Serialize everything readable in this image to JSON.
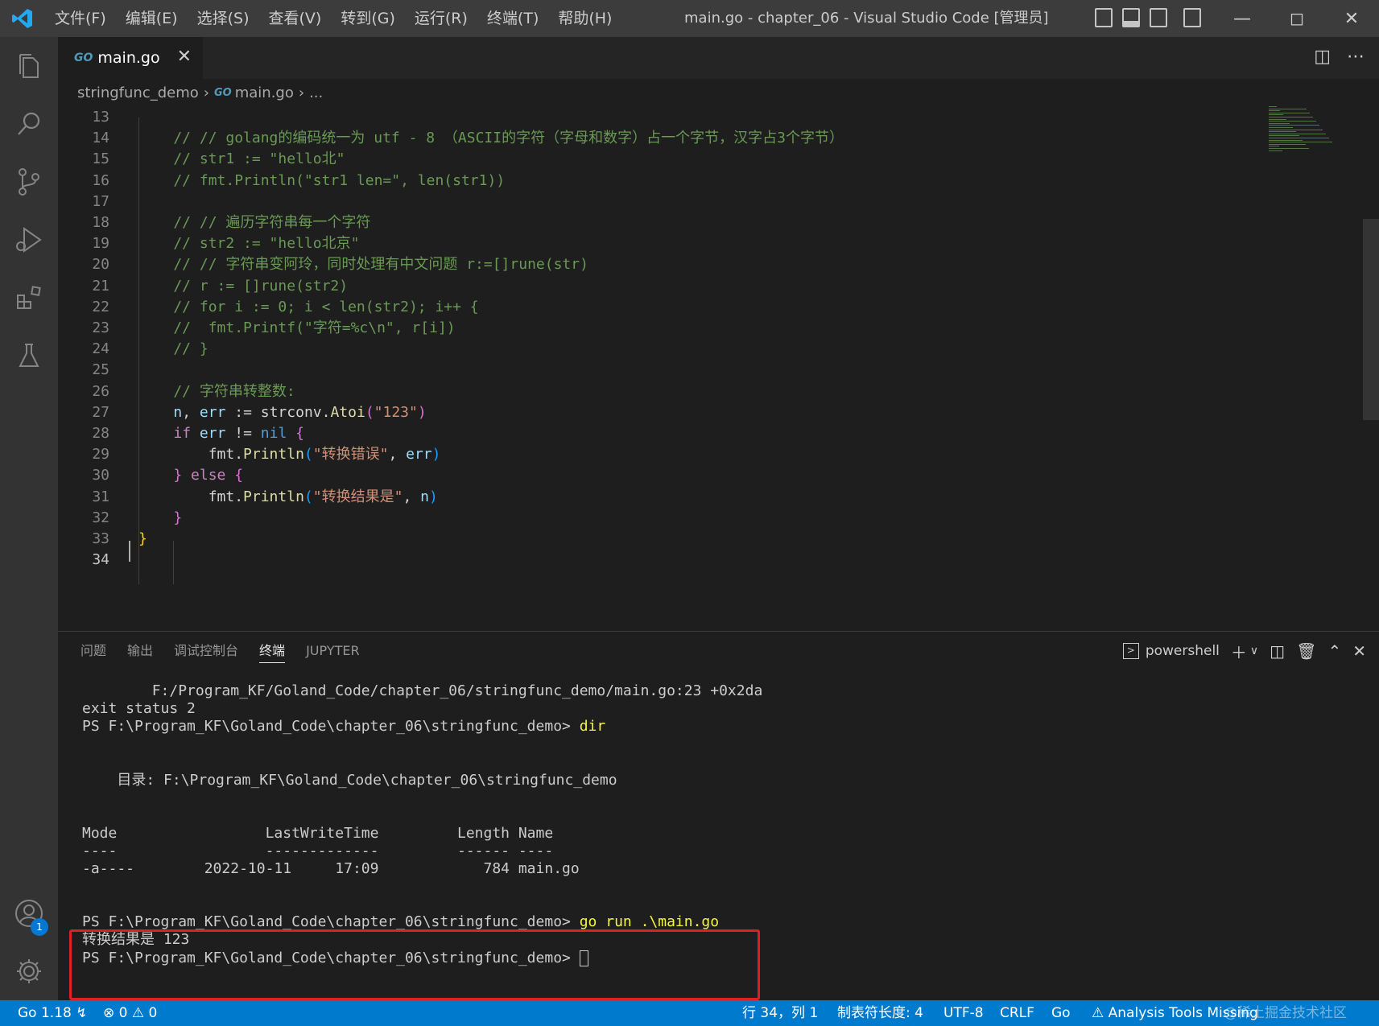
{
  "titlebar": {
    "menu": [
      "文件(F)",
      "编辑(E)",
      "选择(S)",
      "查看(V)",
      "转到(G)",
      "运行(R)",
      "终端(T)",
      "帮助(H)"
    ],
    "title": "main.go - chapter_06 - Visual Studio Code [管理员]"
  },
  "tabs": {
    "active": {
      "icon": "GO",
      "label": "main.go"
    }
  },
  "breadcrumb": {
    "folder": "stringfunc_demo",
    "icon": "GO",
    "file": "main.go",
    "more": "..."
  },
  "editor": {
    "lines": [
      {
        "n": "13",
        "tokens": []
      },
      {
        "n": "14",
        "tokens": [
          [
            "cm",
            "    // // golang的编码统一为 utf - 8 （ASCII的字符（字母和数字）占一个字节，汉字占3个字节）"
          ]
        ]
      },
      {
        "n": "15",
        "tokens": [
          [
            "cm",
            "    // str1 := \"hello北\""
          ]
        ]
      },
      {
        "n": "16",
        "tokens": [
          [
            "cm",
            "    // fmt.Println(\"str1 len=\", len(str1))"
          ]
        ]
      },
      {
        "n": "17",
        "tokens": []
      },
      {
        "n": "18",
        "tokens": [
          [
            "cm",
            "    // // 遍历字符串每一个字符"
          ]
        ]
      },
      {
        "n": "19",
        "tokens": [
          [
            "cm",
            "    // str2 := \"hello北京\""
          ]
        ]
      },
      {
        "n": "20",
        "tokens": [
          [
            "cm",
            "    // // 字符串变阿玲，同时处理有中文问题 r:=[]rune(str)"
          ]
        ]
      },
      {
        "n": "21",
        "tokens": [
          [
            "cm",
            "    // r := []rune(str2)"
          ]
        ]
      },
      {
        "n": "22",
        "tokens": [
          [
            "cm",
            "    // for i := 0; i < len(str2); i++ {"
          ]
        ]
      },
      {
        "n": "23",
        "tokens": [
          [
            "cm",
            "    //  fmt.Printf(\"字符=%c\\n\", r[i])"
          ]
        ]
      },
      {
        "n": "24",
        "tokens": [
          [
            "cm",
            "    // }"
          ]
        ]
      },
      {
        "n": "25",
        "tokens": []
      },
      {
        "n": "26",
        "tokens": [
          [
            "cm",
            "    // 字符串转整数:"
          ]
        ]
      },
      {
        "n": "27",
        "tokens": [
          [
            "pkg",
            "    "
          ],
          [
            "var",
            "n"
          ],
          [
            "pkg",
            ", "
          ],
          [
            "var",
            "err"
          ],
          [
            "pkg",
            " := strconv."
          ],
          [
            "fn",
            "Atoi"
          ],
          [
            "br2",
            "("
          ],
          [
            "str",
            "\"123\""
          ],
          [
            "br2",
            ")"
          ]
        ]
      },
      {
        "n": "28",
        "tokens": [
          [
            "pkg",
            "    "
          ],
          [
            "kw",
            "if"
          ],
          [
            "pkg",
            " "
          ],
          [
            "var",
            "err"
          ],
          [
            "pkg",
            " != "
          ],
          [
            "kw2",
            "nil"
          ],
          [
            "pkg",
            " "
          ],
          [
            "br2",
            "{"
          ]
        ]
      },
      {
        "n": "29",
        "tokens": [
          [
            "pkg",
            "        fmt."
          ],
          [
            "fn",
            "Println"
          ],
          [
            "br3",
            "("
          ],
          [
            "str",
            "\"转换错误\""
          ],
          [
            "pkg",
            ", "
          ],
          [
            "var",
            "err"
          ],
          [
            "br3",
            ")"
          ]
        ]
      },
      {
        "n": "30",
        "tokens": [
          [
            "pkg",
            "    "
          ],
          [
            "br2",
            "}"
          ],
          [
            "pkg",
            " "
          ],
          [
            "kw",
            "else"
          ],
          [
            "pkg",
            " "
          ],
          [
            "br2",
            "{"
          ]
        ]
      },
      {
        "n": "31",
        "tokens": [
          [
            "pkg",
            "        fmt."
          ],
          [
            "fn",
            "Println"
          ],
          [
            "br3",
            "("
          ],
          [
            "str",
            "\"转换结果是\""
          ],
          [
            "pkg",
            ", "
          ],
          [
            "var",
            "n"
          ],
          [
            "br3",
            ")"
          ]
        ]
      },
      {
        "n": "32",
        "tokens": [
          [
            "pkg",
            "    "
          ],
          [
            "br2",
            "}"
          ]
        ]
      },
      {
        "n": "33",
        "tokens": [
          [
            "br1",
            "}"
          ]
        ]
      },
      {
        "n": "34",
        "tokens": [],
        "active": true
      }
    ]
  },
  "panel": {
    "tabs": [
      "问题",
      "输出",
      "调试控制台",
      "终端",
      "JUPYTER"
    ],
    "active_tab": "终端",
    "shell": "powershell",
    "terminal": [
      {
        "text": "        F:/Program_KF/Goland_Code/chapter_06/stringfunc_demo/main.go:23 +0x2da",
        "cmd": ""
      },
      {
        "text": "exit status 2",
        "cmd": ""
      },
      {
        "text": "PS F:\\Program_KF\\Goland_Code\\chapter_06\\stringfunc_demo> ",
        "cmd": "dir"
      },
      {
        "text": "",
        "cmd": ""
      },
      {
        "text": "",
        "cmd": ""
      },
      {
        "text": "    目录: F:\\Program_KF\\Goland_Code\\chapter_06\\stringfunc_demo",
        "cmd": ""
      },
      {
        "text": "",
        "cmd": ""
      },
      {
        "text": "",
        "cmd": ""
      },
      {
        "text": "Mode                 LastWriteTime         Length Name",
        "cmd": ""
      },
      {
        "text": "----                 -------------         ------ ----",
        "cmd": ""
      },
      {
        "text": "-a----        2022-10-11     17:09            784 main.go",
        "cmd": ""
      },
      {
        "text": "",
        "cmd": ""
      },
      {
        "text": "",
        "cmd": ""
      },
      {
        "text": "PS F:\\Program_KF\\Goland_Code\\chapter_06\\stringfunc_demo> ",
        "cmd": "go run .\\main.go"
      },
      {
        "text": "转换结果是 123",
        "cmd": ""
      },
      {
        "text": "PS F:\\Program_KF\\Goland_Code\\chapter_06\\stringfunc_demo> ",
        "cmd": "",
        "cursor": true
      }
    ]
  },
  "statusbar": {
    "go_version": "Go 1.18",
    "errors": "0",
    "warnings": "0",
    "position": "行 34，列 1",
    "indent": "制表符长度: 4",
    "encoding": "UTF-8",
    "eol": "CRLF",
    "language": "Go",
    "analysis": "Analysis Tools Missing",
    "watermark": "@稀土掘金技术社区"
  },
  "accounts": {
    "badge": "1"
  },
  "colors": {
    "accent": "#007acc",
    "highlight_box": "#e02020"
  }
}
